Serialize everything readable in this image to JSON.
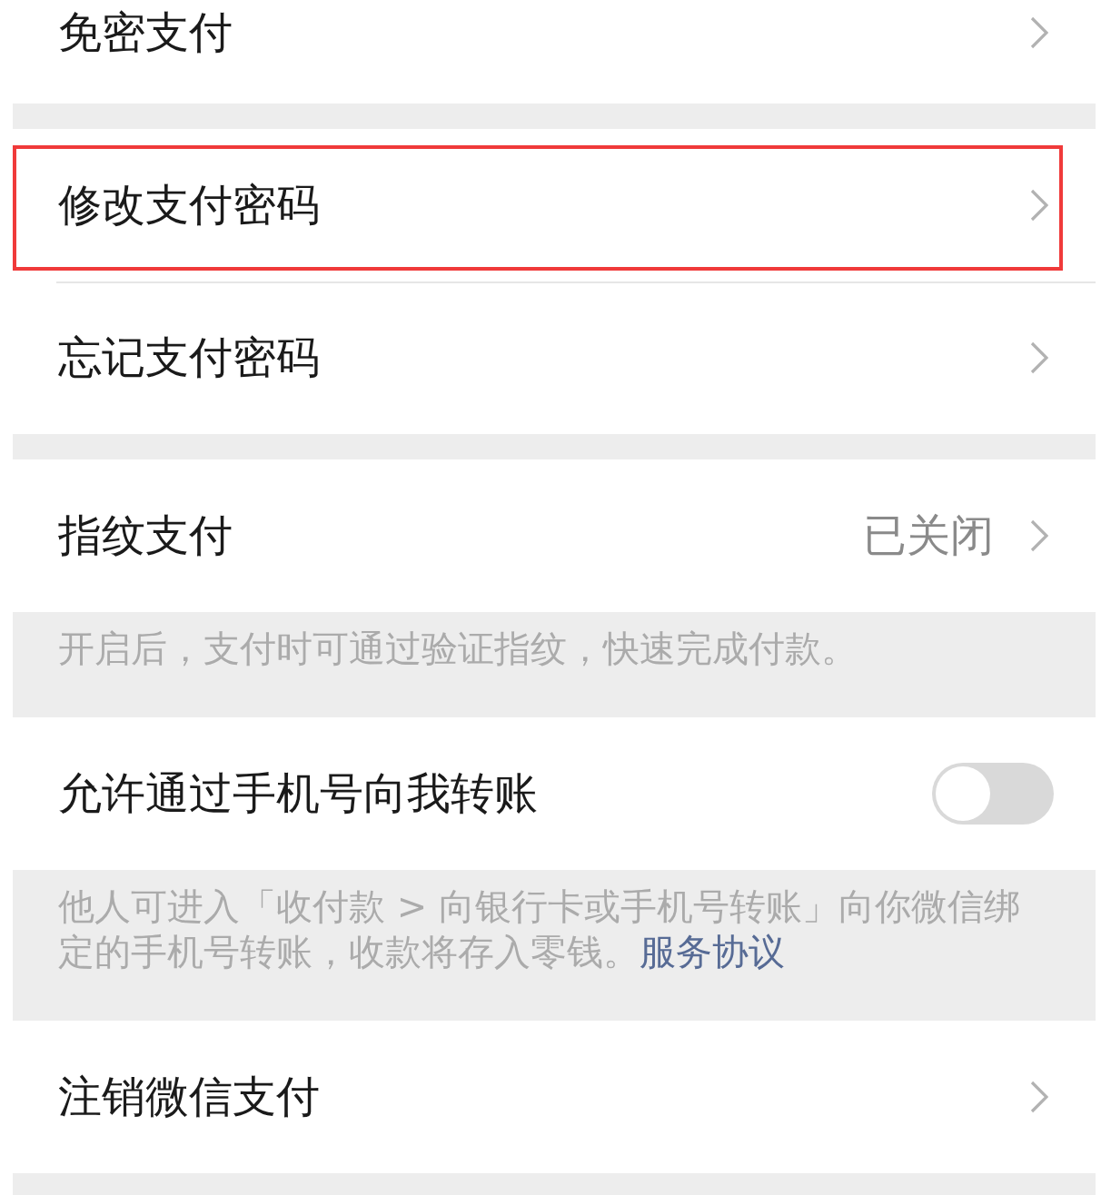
{
  "groups": [
    {
      "items": [
        {
          "kind": "link",
          "label": "免密支付",
          "highlighted": false
        }
      ]
    },
    {
      "items": [
        {
          "kind": "link",
          "label": "修改支付密码",
          "highlighted": true
        },
        {
          "kind": "link",
          "label": "忘记支付密码",
          "highlighted": false
        }
      ]
    },
    {
      "items": [
        {
          "kind": "link",
          "label": "指纹支付",
          "value": "已关闭",
          "highlighted": false
        }
      ],
      "note": "开启后，支付时可通过验证指纹，快速完成付款。"
    },
    {
      "items": [
        {
          "kind": "switch",
          "label": "允许通过手机号向我转账",
          "on": false
        }
      ],
      "note": "他人可进入「收付款 > 向银行卡或手机号转账」向你微信绑定的手机号转账，收款将存入零钱。",
      "note_link": "服务协议"
    },
    {
      "items": [
        {
          "kind": "link",
          "label": "注销微信支付",
          "highlighted": false
        }
      ]
    }
  ]
}
